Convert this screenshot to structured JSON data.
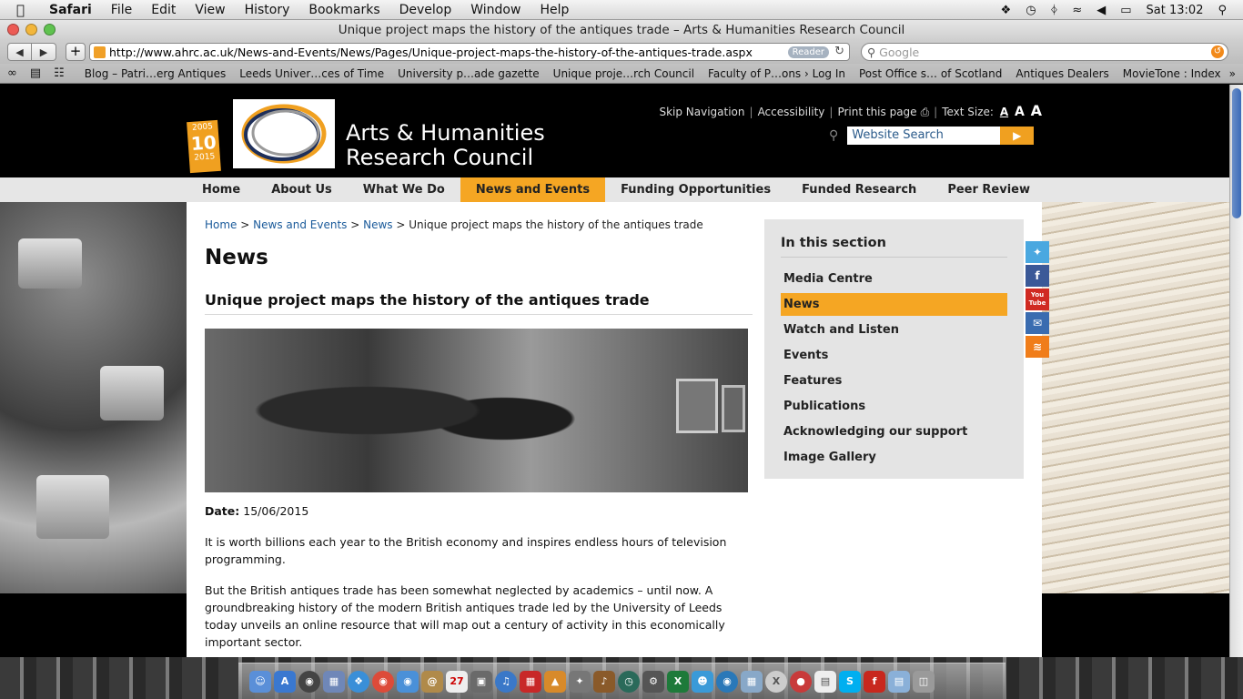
{
  "menubar": {
    "app": "Safari",
    "items": [
      "File",
      "Edit",
      "View",
      "History",
      "Bookmarks",
      "Develop",
      "Window",
      "Help"
    ],
    "clock": "Sat 13:02"
  },
  "window": {
    "title": "Unique project maps the history of the antiques trade – Arts & Humanities Research Council"
  },
  "toolbar": {
    "url": "http://www.ahrc.ac.uk/News-and-Events/News/Pages/Unique-project-maps-the-history-of-the-antiques-trade.aspx",
    "reader_label": "Reader",
    "search_placeholder": "Google"
  },
  "bookmarks": [
    "Blog – Patri…erg Antiques",
    "Leeds Univer…ces of Time",
    "University p…ade gazette",
    "Unique proje…rch Council",
    "Faculty of P…ons › Log In",
    "Post Office s… of Scotland",
    "Antiques Dealers",
    "MovieTone : Index"
  ],
  "site": {
    "logo_years": {
      "top": "2005",
      "mid": "10",
      "bottom": "2015"
    },
    "name_line1": "Arts & Humanities",
    "name_line2": "Research Council",
    "utils": {
      "skip": "Skip Navigation",
      "accessibility": "Accessibility",
      "print": "Print this page",
      "text_size": "Text Size:",
      "sizes": [
        "A",
        "A",
        "A"
      ]
    },
    "search_placeholder": "Website Search",
    "nav": [
      "Home",
      "About Us",
      "What We Do",
      "News and Events",
      "Funding Opportunities",
      "Funded Research",
      "Peer Review"
    ],
    "nav_active": "News and Events",
    "accent": "#f5a623"
  },
  "article": {
    "breadcrumb": [
      "Home",
      "News and Events",
      "News",
      "Unique project maps the history of the antiques trade"
    ],
    "section_title": "News",
    "headline": "Unique project maps the history of the antiques trade",
    "date_label": "Date:",
    "date": "15/06/2015",
    "para1": "It is worth billions each year to the British economy and inspires endless hours of television programming.",
    "para2": "But the British antiques trade has been somewhat neglected by academics – until now. A groundbreaking history of the modern British antiques trade led by the University of Leeds today unveils an online resource that will map out a century of activity in this economically important sector."
  },
  "sidebar": {
    "title": "In this section",
    "items": [
      "Media Centre",
      "News",
      "Watch and Listen",
      "Events",
      "Features",
      "Publications",
      "Acknowledging our support",
      "Image Gallery"
    ],
    "active": "News"
  },
  "social": {
    "icons": [
      "twitter-icon",
      "facebook-icon",
      "youtube-icon",
      "email-icon",
      "rss-icon"
    ],
    "youtube_label": "You Tube"
  }
}
